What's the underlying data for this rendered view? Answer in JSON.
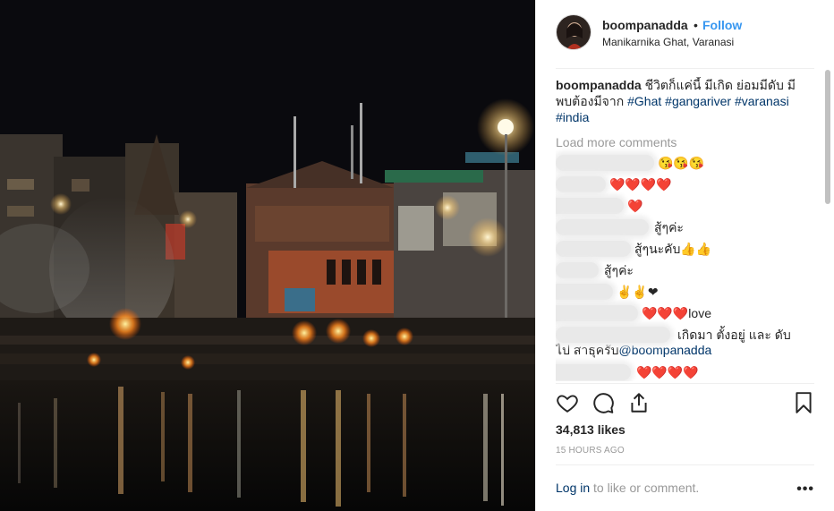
{
  "post": {
    "username": "boompanadda",
    "dot": "•",
    "follow_label": "Follow",
    "location": "Manikarnika Ghat, Varanasi",
    "caption": {
      "username": "boompanadda",
      "text": "ชีวิตก็แค่นี้ มีเกิด ย่อมมีดับ มีพบต้องมีจาก",
      "hashtags": [
        "#Ghat",
        "#gangariver",
        "#varanasi",
        "#india"
      ]
    },
    "load_more": "Load more comments",
    "comments": [
      {
        "text": "😘😘😘"
      },
      {
        "text": "❤️❤️❤️❤️"
      },
      {
        "text": "❤️"
      },
      {
        "text": "สู้ๆค่ะ"
      },
      {
        "text": "สู้ๆนะคับ👍👍"
      },
      {
        "text": "สู้ๆค่ะ"
      },
      {
        "text": "✌✌❤"
      },
      {
        "text": "❤️❤️❤️love"
      },
      {
        "text": "เกิดมา ตั้งอยู่ และ ดับ",
        "line2_prefix": "ไป สาธุครับ",
        "mention": "@boompanadda"
      },
      {
        "text": "❤️❤️❤️❤️"
      }
    ],
    "likes": "34,813 likes",
    "time": "15 HOURS AGO",
    "login": {
      "link": "Log in",
      "rest": " to like or comment."
    },
    "more": "•••"
  },
  "icons": [
    "heart-icon",
    "comment-icon",
    "share-icon",
    "bookmark-icon"
  ],
  "colors": {
    "link_blue": "#3897f0",
    "hashtag": "#003569",
    "muted": "#999999"
  }
}
